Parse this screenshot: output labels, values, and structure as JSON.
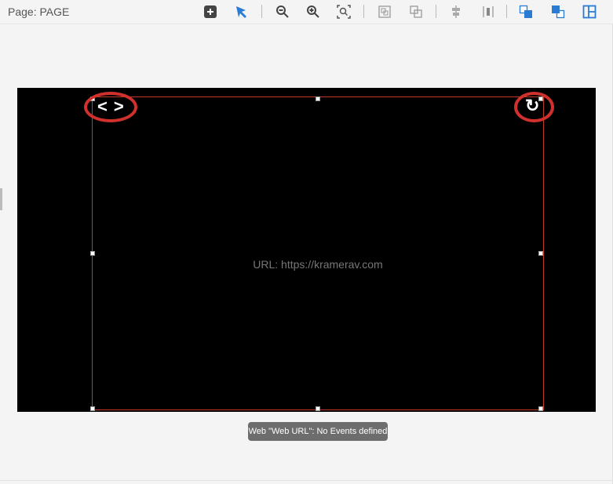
{
  "header": {
    "title": "Page: PAGE"
  },
  "toolbar": {
    "icons": [
      "add-icon",
      "select-pointer-icon",
      "zoom-out-icon",
      "zoom-in-icon",
      "zoom-fit-icon",
      "group-icon",
      "ungroup-icon",
      "align-center-icon",
      "distribute-icon",
      "send-backward-icon",
      "bring-forward-icon",
      "layout-icon"
    ]
  },
  "canvas": {
    "url_label": "URL: https://kramerav.com",
    "nav_back": "<",
    "nav_forward": ">",
    "refresh": "↻"
  },
  "tooltip": {
    "text": "Web \"Web URL\": No Events defined"
  },
  "colors": {
    "accent": "#2a7bd4",
    "highlight": "#d0312d",
    "selection": "#c0392b"
  }
}
